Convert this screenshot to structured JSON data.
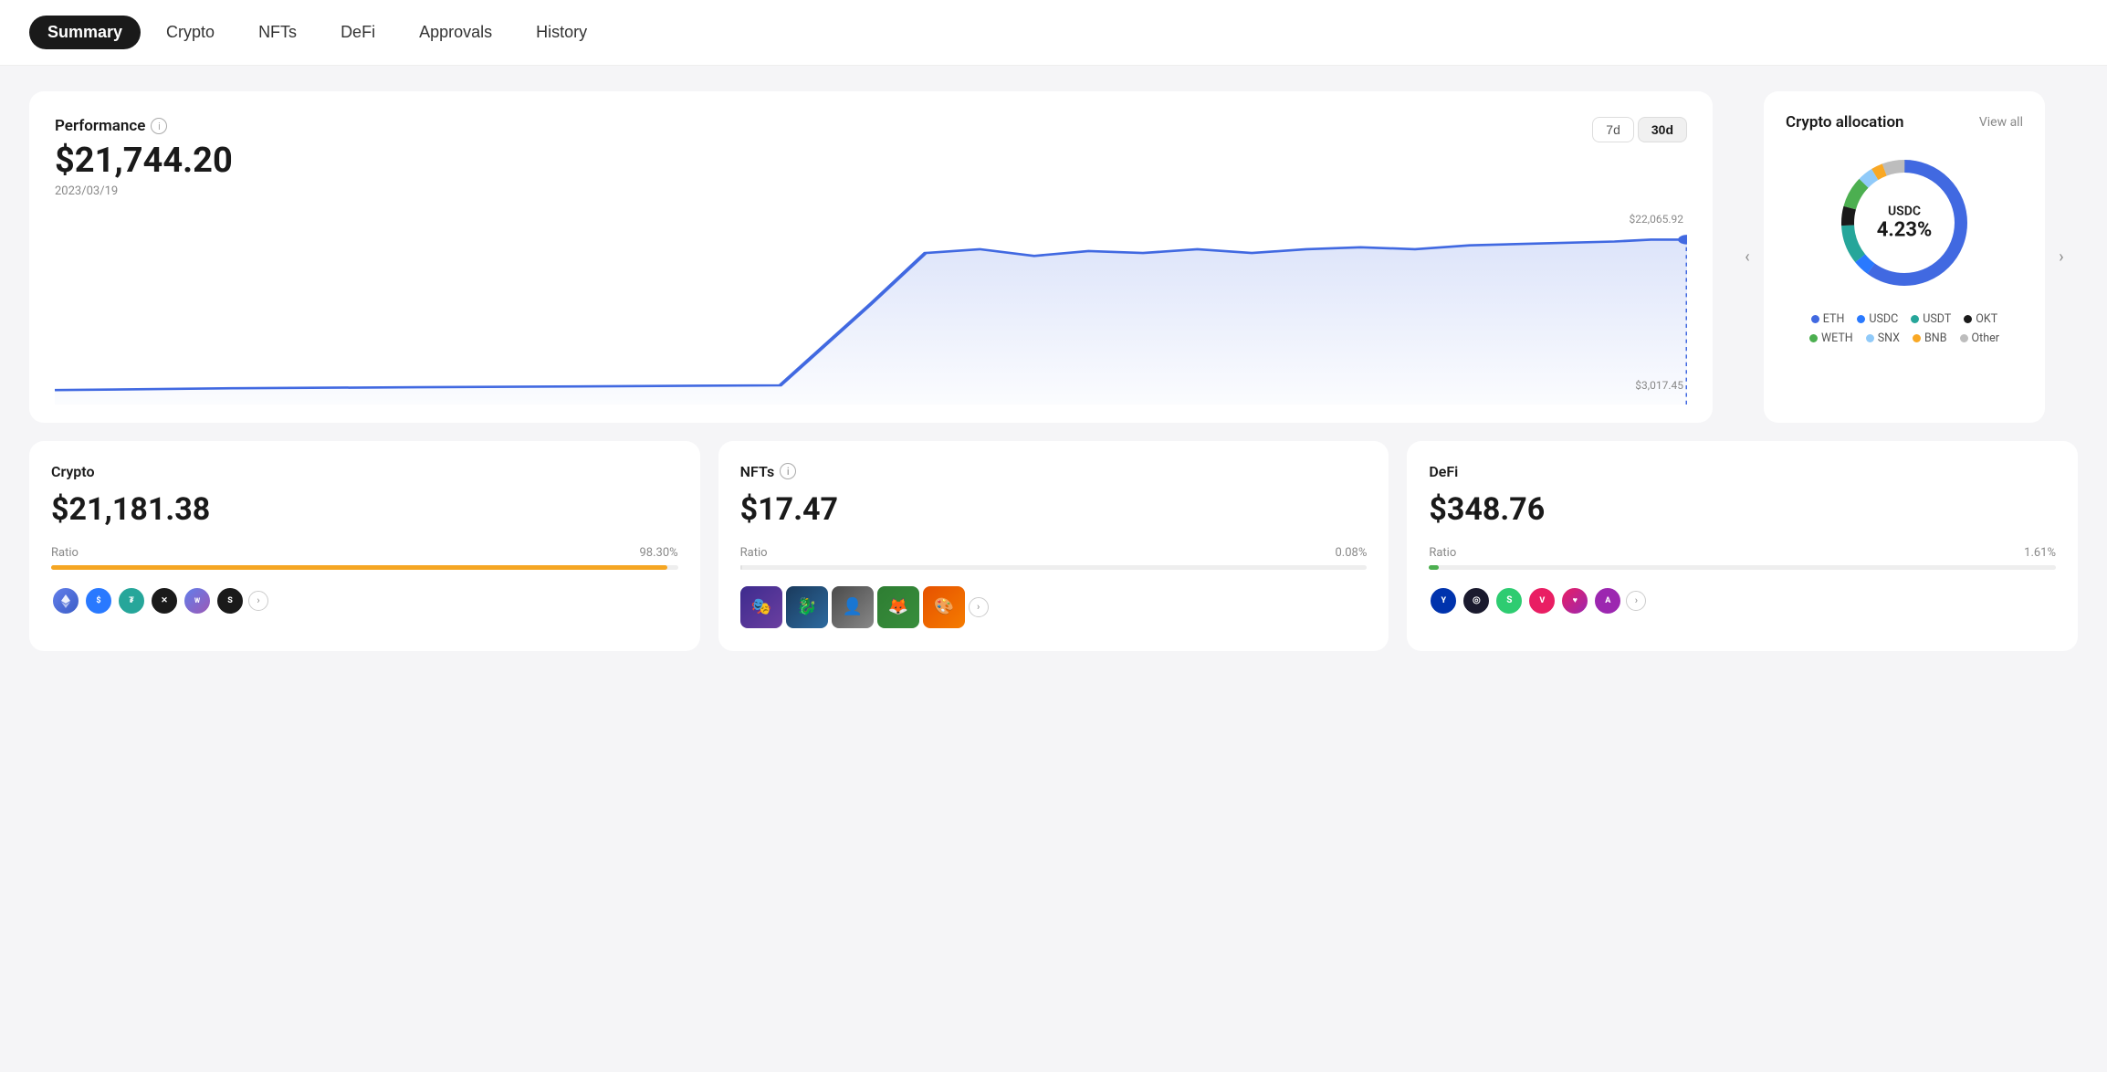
{
  "nav": {
    "items": [
      {
        "label": "Summary",
        "active": true
      },
      {
        "label": "Crypto",
        "active": false
      },
      {
        "label": "NFTs",
        "active": false
      },
      {
        "label": "DeFi",
        "active": false
      },
      {
        "label": "Approvals",
        "active": false
      },
      {
        "label": "History",
        "active": false
      }
    ]
  },
  "performance": {
    "title": "Performance",
    "value": "$21,744.20",
    "date": "2023/03/19",
    "chart_max": "$22,065.92",
    "chart_min": "$3,017.45",
    "time_buttons": [
      "7d",
      "30d"
    ],
    "active_time": "30d"
  },
  "allocation": {
    "title": "Crypto allocation",
    "view_all": "View all",
    "center_label": "USDC",
    "center_pct": "4.23%",
    "legend": [
      {
        "label": "ETH",
        "color": "#4169e1"
      },
      {
        "label": "USDC",
        "color": "#2979ff"
      },
      {
        "label": "USDT",
        "color": "#26a69a"
      },
      {
        "label": "OKT",
        "color": "#1a1a1a"
      },
      {
        "label": "WETH",
        "color": "#4caf50"
      },
      {
        "label": "SNX",
        "color": "#90caf9"
      },
      {
        "label": "BNB",
        "color": "#f9a825"
      },
      {
        "label": "Other",
        "color": "#bdbdbd"
      }
    ]
  },
  "crypto_card": {
    "title": "Crypto",
    "value": "$21,181.38",
    "ratio_label": "Ratio",
    "ratio_pct": "98.30%",
    "bar_color": "#f5a623",
    "bar_fill": 98.3
  },
  "nfts_card": {
    "title": "NFTs",
    "value": "$17.47",
    "ratio_label": "Ratio",
    "ratio_pct": "0.08%",
    "bar_color": "#e0e0e0",
    "bar_fill": 0.08
  },
  "defi_card": {
    "title": "DeFi",
    "value": "$348.76",
    "ratio_label": "Ratio",
    "ratio_pct": "1.61%",
    "bar_color": "#4caf50",
    "bar_fill": 1.61
  },
  "icons": {
    "chevron_left": "‹",
    "chevron_right": "›",
    "info": "i"
  }
}
